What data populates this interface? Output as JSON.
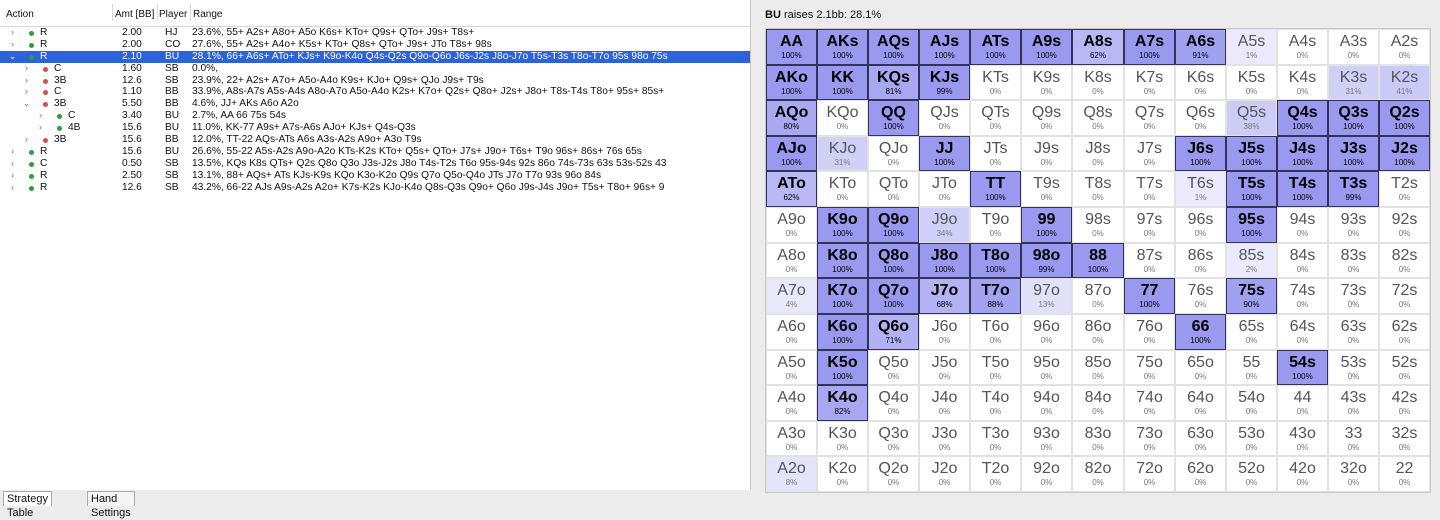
{
  "left": {
    "headers": {
      "action": "Action",
      "amt": "Amt [BB]",
      "player": "Player",
      "range": "Range"
    },
    "rows": [
      {
        "indent": 0,
        "chev": "›",
        "dot": "#2e9b3e",
        "action": "R",
        "amt": "2.00",
        "player": "HJ",
        "range": "23.6%, 55+ A2s+ A8o+ A5o K6s+ KTo+ Q9s+ QTo+ J9s+ T8s+",
        "sel": false
      },
      {
        "indent": 0,
        "chev": "›",
        "dot": "#2e9b3e",
        "action": "R",
        "amt": "2.00",
        "player": "CO",
        "range": "27.6%, 55+ A2s+ A4o+ K5s+ KTo+ Q8s+ QTo+ J9s+ JTo T8s+ 98s",
        "sel": false
      },
      {
        "indent": 0,
        "chev": "⌄",
        "dot": "#2e9b3e",
        "action": "R",
        "amt": "2.10",
        "player": "BU",
        "range": "28.1%, 66+ A6s+ ATo+ KJs+ K9o-K4o Q4s-Q2s Q9o-Q6o J6s-J2s J8o-J7o T5s-T3s T8o-T7o 95s 98o 75s",
        "sel": true
      },
      {
        "indent": 1,
        "chev": "›",
        "dot": "#d94c4c",
        "action": "C",
        "amt": "1.60",
        "player": "SB",
        "range": "0.0%,",
        "sel": false
      },
      {
        "indent": 1,
        "chev": "›",
        "dot": "#d94c4c",
        "action": "3B",
        "amt": "12.6",
        "player": "SB",
        "range": "23.9%, 22+ A2s+ A7o+ A5o-A4o K9s+ KJo+ Q9s+ QJo J9s+ T9s",
        "sel": false
      },
      {
        "indent": 1,
        "chev": "›",
        "dot": "#d94c4c",
        "action": "C",
        "amt": "1.10",
        "player": "BB",
        "range": "33.9%, A8s-A7s A5s-A4s A8o-A7o A5o-A4o K2s+ K7o+ Q2s+ Q8o+ J2s+ J8o+ T8s-T4s T8o+ 95s+ 85s+",
        "sel": false
      },
      {
        "indent": 1,
        "chev": "⌄",
        "dot": "#d94c4c",
        "action": "3B",
        "amt": "5.50",
        "player": "BB",
        "range": "4.6%, JJ+ AKs A6o A2o",
        "sel": false
      },
      {
        "indent": 2,
        "chev": "›",
        "dot": "#2e9b3e",
        "action": "C",
        "amt": "3.40",
        "player": "BU",
        "range": "2.7%, AA 66 75s 54s",
        "sel": false
      },
      {
        "indent": 2,
        "chev": "›",
        "dot": "#2e9b3e",
        "action": "4B",
        "amt": "15.6",
        "player": "BU",
        "range": "11.0%, KK-77 A9s+ A7s-A6s AJo+ KJs+ Q4s-Q3s",
        "sel": false
      },
      {
        "indent": 1,
        "chev": "›",
        "dot": "#d94c4c",
        "action": "3B",
        "amt": "15.6",
        "player": "BB",
        "range": "12.0%, TT-22 AQs-ATs A6s A3s-A2s A9o+ A3o T9s",
        "sel": false
      },
      {
        "indent": 0,
        "chev": "›",
        "dot": "#2e9b3e",
        "action": "R",
        "amt": "15.6",
        "player": "BU",
        "range": "26.6%, 55-22 A5s-A2s A9o-A2o KTs-K2s KTo+ Q5s+ QTo+ J7s+ J9o+ T6s+ T9o 96s+ 86s+ 76s 65s",
        "sel": false
      },
      {
        "indent": 0,
        "chev": "›",
        "dot": "#2e9b3e",
        "action": "C",
        "amt": "0.50",
        "player": "SB",
        "range": "13.5%, KQs K8s QTs+ Q2s Q8o Q3o J3s-J2s J8o T4s-T2s T6o 95s-94s 92s 86o 74s-73s 63s 53s-52s 43",
        "sel": false
      },
      {
        "indent": 0,
        "chev": "›",
        "dot": "#2e9b3e",
        "action": "R",
        "amt": "2.50",
        "player": "SB",
        "range": "13.1%, 88+ AQs+ ATs KJs-K9s KQo K3o-K2o Q9s Q7o Q5o-Q4o JTs J7o T7o 93s 96o 84s",
        "sel": false
      },
      {
        "indent": 0,
        "chev": "›",
        "dot": "#2e9b3e",
        "action": "R",
        "amt": "12.6",
        "player": "SB",
        "range": "43.2%, 66-22 AJs A9s-A2s A2o+ K7s-K2s KJo-K4o Q8s-Q3s Q9o+ Q6o J9s-J4s J9o+ T5s+ T8o+ 96s+ 9",
        "sel": false
      }
    ],
    "tabs": [
      "Strategy Table",
      "Hand Settings"
    ]
  },
  "right": {
    "title_player": "BU",
    "title_rest": " raises 2.1bb: 28.1%",
    "colors": {
      "fill": "#9d9df4",
      "empty": "#ffffff",
      "border_hi": "#33335a",
      "grid_line": "#e2e2e2"
    },
    "matrix": [
      [
        [
          "AA",
          "100%"
        ],
        [
          "AKs",
          "100%"
        ],
        [
          "AQs",
          "100%"
        ],
        [
          "AJs",
          "100%"
        ],
        [
          "ATs",
          "100%"
        ],
        [
          "A9s",
          "100%"
        ],
        [
          "A8s",
          "62%"
        ],
        [
          "A7s",
          "100%"
        ],
        [
          "A6s",
          "91%"
        ],
        [
          "A5s",
          "1%"
        ],
        [
          "A4s",
          "0%"
        ],
        [
          "A3s",
          "0%"
        ],
        [
          "A2s",
          "0%"
        ]
      ],
      [
        [
          "AKo",
          "100%"
        ],
        [
          "KK",
          "100%"
        ],
        [
          "KQs",
          "81%"
        ],
        [
          "KJs",
          "99%"
        ],
        [
          "KTs",
          "0%"
        ],
        [
          "K9s",
          "0%"
        ],
        [
          "K8s",
          "0%"
        ],
        [
          "K7s",
          "0%"
        ],
        [
          "K6s",
          "0%"
        ],
        [
          "K5s",
          "0%"
        ],
        [
          "K4s",
          "0%"
        ],
        [
          "K3s",
          "31%"
        ],
        [
          "K2s",
          "41%"
        ]
      ],
      [
        [
          "AQo",
          "80%"
        ],
        [
          "KQo",
          "0%"
        ],
        [
          "QQ",
          "100%"
        ],
        [
          "QJs",
          "0%"
        ],
        [
          "QTs",
          "0%"
        ],
        [
          "Q9s",
          "0%"
        ],
        [
          "Q8s",
          "0%"
        ],
        [
          "Q7s",
          "0%"
        ],
        [
          "Q6s",
          "0%"
        ],
        [
          "Q5s",
          "38%"
        ],
        [
          "Q4s",
          "100%"
        ],
        [
          "Q3s",
          "100%"
        ],
        [
          "Q2s",
          "100%"
        ]
      ],
      [
        [
          "AJo",
          "100%"
        ],
        [
          "KJo",
          "31%"
        ],
        [
          "QJo",
          "0%"
        ],
        [
          "JJ",
          "100%"
        ],
        [
          "JTs",
          "0%"
        ],
        [
          "J9s",
          "0%"
        ],
        [
          "J8s",
          "0%"
        ],
        [
          "J7s",
          "0%"
        ],
        [
          "J6s",
          "100%"
        ],
        [
          "J5s",
          "100%"
        ],
        [
          "J4s",
          "100%"
        ],
        [
          "J3s",
          "100%"
        ],
        [
          "J2s",
          "100%"
        ]
      ],
      [
        [
          "ATo",
          "62%"
        ],
        [
          "KTo",
          "0%"
        ],
        [
          "QTo",
          "0%"
        ],
        [
          "JTo",
          "0%"
        ],
        [
          "TT",
          "100%"
        ],
        [
          "T9s",
          "0%"
        ],
        [
          "T8s",
          "0%"
        ],
        [
          "T7s",
          "0%"
        ],
        [
          "T6s",
          "1%"
        ],
        [
          "T5s",
          "100%"
        ],
        [
          "T4s",
          "100%"
        ],
        [
          "T3s",
          "99%"
        ],
        [
          "T2s",
          "0%"
        ]
      ],
      [
        [
          "A9o",
          "0%"
        ],
        [
          "K9o",
          "100%"
        ],
        [
          "Q9o",
          "100%"
        ],
        [
          "J9o",
          "34%"
        ],
        [
          "T9o",
          "0%"
        ],
        [
          "99",
          "100%"
        ],
        [
          "98s",
          "0%"
        ],
        [
          "97s",
          "0%"
        ],
        [
          "96s",
          "0%"
        ],
        [
          "95s",
          "100%"
        ],
        [
          "94s",
          "0%"
        ],
        [
          "93s",
          "0%"
        ],
        [
          "92s",
          "0%"
        ]
      ],
      [
        [
          "A8o",
          "0%"
        ],
        [
          "K8o",
          "100%"
        ],
        [
          "Q8o",
          "100%"
        ],
        [
          "J8o",
          "100%"
        ],
        [
          "T8o",
          "100%"
        ],
        [
          "98o",
          "99%"
        ],
        [
          "88",
          "100%"
        ],
        [
          "87s",
          "0%"
        ],
        [
          "86s",
          "0%"
        ],
        [
          "85s",
          "2%"
        ],
        [
          "84s",
          "0%"
        ],
        [
          "83s",
          "0%"
        ],
        [
          "82s",
          "0%"
        ]
      ],
      [
        [
          "A7o",
          "4%"
        ],
        [
          "K7o",
          "100%"
        ],
        [
          "Q7o",
          "100%"
        ],
        [
          "J7o",
          "68%"
        ],
        [
          "T7o",
          "88%"
        ],
        [
          "97o",
          "13%"
        ],
        [
          "87o",
          "0%"
        ],
        [
          "77",
          "100%"
        ],
        [
          "76s",
          "0%"
        ],
        [
          "75s",
          "90%"
        ],
        [
          "74s",
          "0%"
        ],
        [
          "73s",
          "0%"
        ],
        [
          "72s",
          "0%"
        ]
      ],
      [
        [
          "A6o",
          "0%"
        ],
        [
          "K6o",
          "100%"
        ],
        [
          "Q6o",
          "71%"
        ],
        [
          "J6o",
          "0%"
        ],
        [
          "T6o",
          "0%"
        ],
        [
          "96o",
          "0%"
        ],
        [
          "86o",
          "0%"
        ],
        [
          "76o",
          "0%"
        ],
        [
          "66",
          "100%"
        ],
        [
          "65s",
          "0%"
        ],
        [
          "64s",
          "0%"
        ],
        [
          "63s",
          "0%"
        ],
        [
          "62s",
          "0%"
        ]
      ],
      [
        [
          "A5o",
          "0%"
        ],
        [
          "K5o",
          "100%"
        ],
        [
          "Q5o",
          "0%"
        ],
        [
          "J5o",
          "0%"
        ],
        [
          "T5o",
          "0%"
        ],
        [
          "95o",
          "0%"
        ],
        [
          "85o",
          "0%"
        ],
        [
          "75o",
          "0%"
        ],
        [
          "65o",
          "0%"
        ],
        [
          "55",
          "0%"
        ],
        [
          "54s",
          "100%"
        ],
        [
          "53s",
          "0%"
        ],
        [
          "52s",
          "0%"
        ]
      ],
      [
        [
          "A4o",
          "0%"
        ],
        [
          "K4o",
          "82%"
        ],
        [
          "Q4o",
          "0%"
        ],
        [
          "J4o",
          "0%"
        ],
        [
          "T4o",
          "0%"
        ],
        [
          "94o",
          "0%"
        ],
        [
          "84o",
          "0%"
        ],
        [
          "74o",
          "0%"
        ],
        [
          "64o",
          "0%"
        ],
        [
          "54o",
          "0%"
        ],
        [
          "44",
          "0%"
        ],
        [
          "43s",
          "0%"
        ],
        [
          "42s",
          "0%"
        ]
      ],
      [
        [
          "A3o",
          "0%"
        ],
        [
          "K3o",
          "0%"
        ],
        [
          "Q3o",
          "0%"
        ],
        [
          "J3o",
          "0%"
        ],
        [
          "T3o",
          "0%"
        ],
        [
          "93o",
          "0%"
        ],
        [
          "83o",
          "0%"
        ],
        [
          "73o",
          "0%"
        ],
        [
          "63o",
          "0%"
        ],
        [
          "53o",
          "0%"
        ],
        [
          "43o",
          "0%"
        ],
        [
          "33",
          "0%"
        ],
        [
          "32s",
          "0%"
        ]
      ],
      [
        [
          "A2o",
          "8%"
        ],
        [
          "K2o",
          "0%"
        ],
        [
          "Q2o",
          "0%"
        ],
        [
          "J2o",
          "0%"
        ],
        [
          "T2o",
          "0%"
        ],
        [
          "92o",
          "0%"
        ],
        [
          "82o",
          "0%"
        ],
        [
          "72o",
          "0%"
        ],
        [
          "62o",
          "0%"
        ],
        [
          "52o",
          "0%"
        ],
        [
          "42o",
          "0%"
        ],
        [
          "32o",
          "0%"
        ],
        [
          "22",
          "0%"
        ]
      ]
    ]
  }
}
